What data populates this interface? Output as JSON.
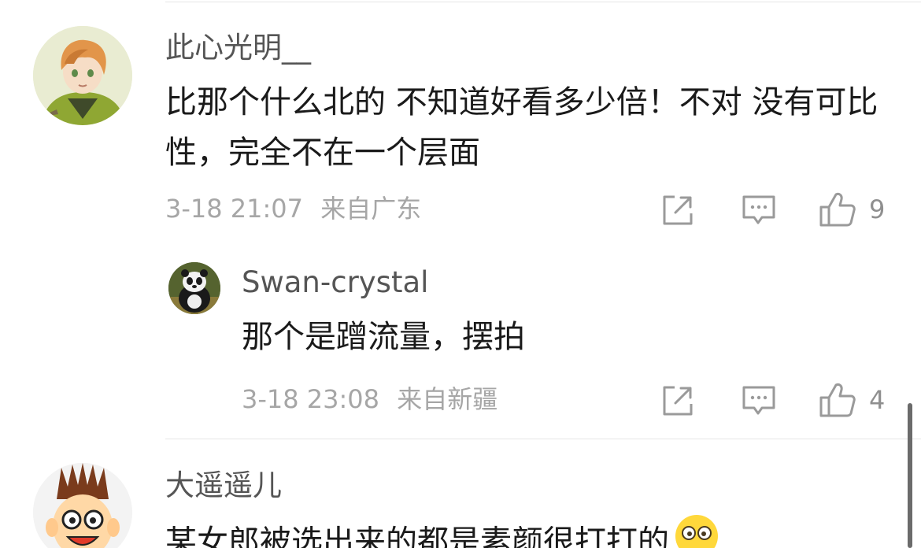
{
  "comments": [
    {
      "username": "此心光明__",
      "text": "比那个什么北的 不知道好看多少倍！不对 没有可比性，完全不在一个层面",
      "time": "3-18 21:07",
      "location": "来自广东",
      "likes": "9"
    },
    {
      "username": "Swan-crystal",
      "text": "那个是蹭流量，摆拍",
      "time": "3-18 23:08",
      "location": "来自新疆",
      "likes": "4"
    },
    {
      "username": "大遥遥儿",
      "text": "某女郎被选出来的都是素颜很打打的"
    }
  ],
  "icons": {
    "share": "share-icon",
    "reply": "comment-icon",
    "like": "thumbs-up-icon",
    "emoji": "thinking-face-emoji"
  },
  "colors": {
    "primary_text": "#1a1a1a",
    "username": "#555555",
    "meta": "#a6a6a6",
    "icon": "#9a9a9a",
    "divider": "#e6e6e6"
  }
}
